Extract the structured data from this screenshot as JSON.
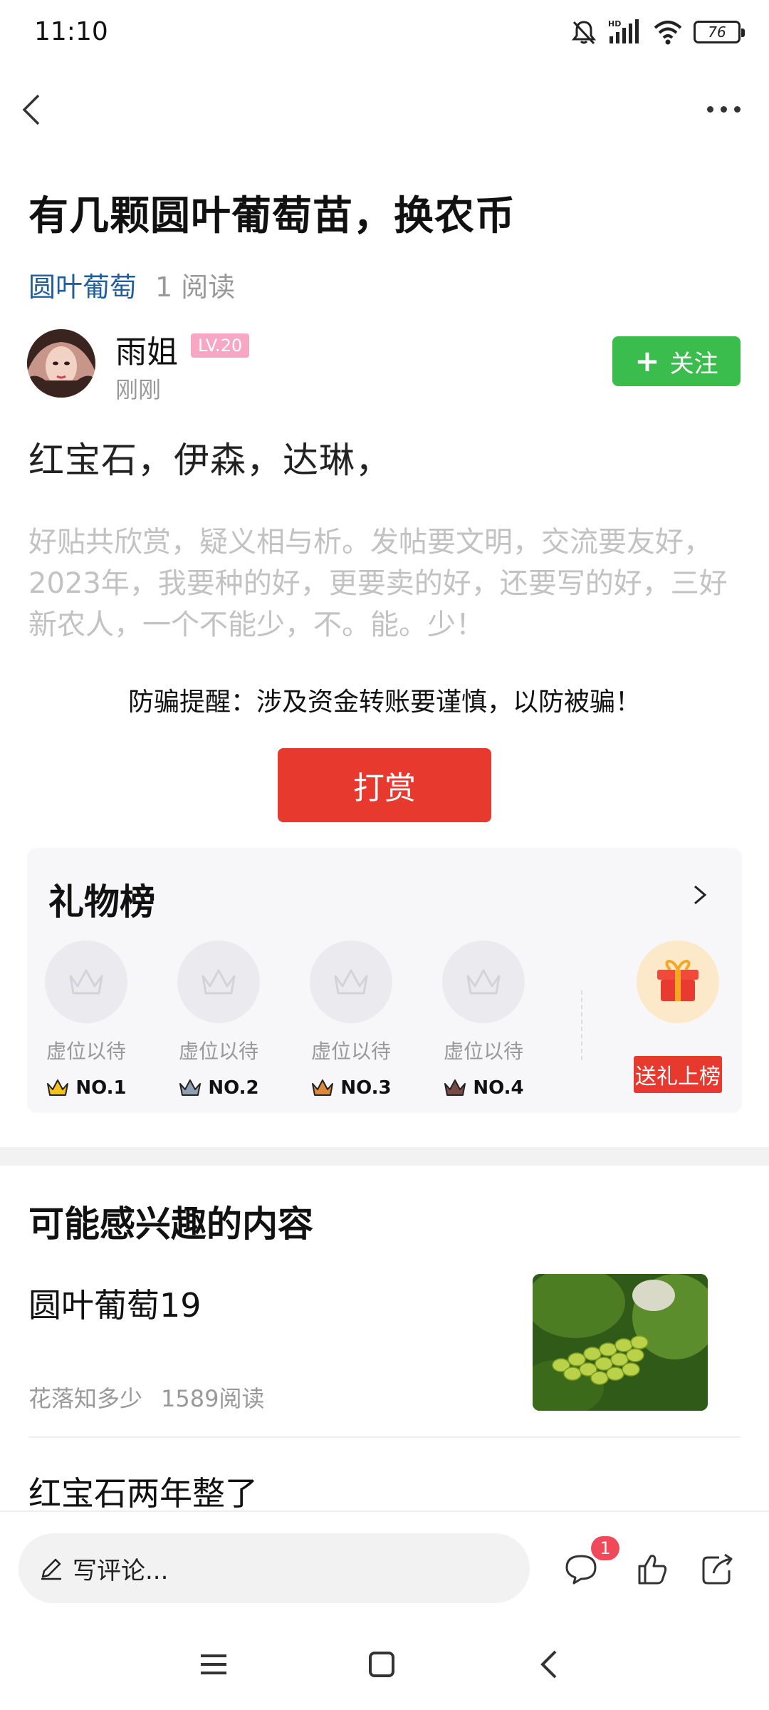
{
  "status_bar": {
    "time": "11:10",
    "battery": "76",
    "icons": [
      "bell-muted-icon",
      "hd-signal-icon",
      "wifi-icon",
      "battery-icon"
    ]
  },
  "nav": {
    "back_icon": "chevron-left-icon",
    "more_icon": "more-horizontal-icon"
  },
  "post": {
    "title": "有几颗圆叶葡萄苗，换农币",
    "topic": "圆叶葡萄",
    "reads": "1 阅读",
    "author": {
      "name": "雨姐",
      "level": "LV.20",
      "time": "刚刚",
      "follow_label": "关注"
    },
    "body": "红宝石，伊森，达琳，",
    "signature": "好贴共欣赏，疑义相与析。发帖要文明，交流要友好，2023年，我要种的好，更要卖的好，还要写的好，三好新农人，一个不能少，不。能。少！",
    "warning": "防骗提醒：涉及资金转账要谨慎，以防被骗！",
    "tip_label": "打赏"
  },
  "gift_board": {
    "title": "礼物榜",
    "slots": [
      {
        "label": "虚位以待",
        "rank": "NO.1",
        "crown_color": "#f3c21b"
      },
      {
        "label": "虚位以待",
        "rank": "NO.2",
        "crown_color": "#8fa0b5"
      },
      {
        "label": "虚位以待",
        "rank": "NO.3",
        "crown_color": "#e0883a"
      },
      {
        "label": "虚位以待",
        "rank": "NO.4",
        "crown_color": "#7a4a44"
      }
    ],
    "cta_label": "送礼上榜"
  },
  "recommendations": {
    "title": "可能感兴趣的内容",
    "items": [
      {
        "title": "圆叶葡萄19",
        "author": "花落知多少",
        "reads": "1589阅读"
      },
      {
        "title": "红宝石两年整了"
      }
    ]
  },
  "bottom_bar": {
    "comment_placeholder": "写评论...",
    "comment_count": "1"
  },
  "colors": {
    "accent_green": "#3bbd4e",
    "accent_red": "#e8392f",
    "topic_blue": "#1f5fa0"
  }
}
